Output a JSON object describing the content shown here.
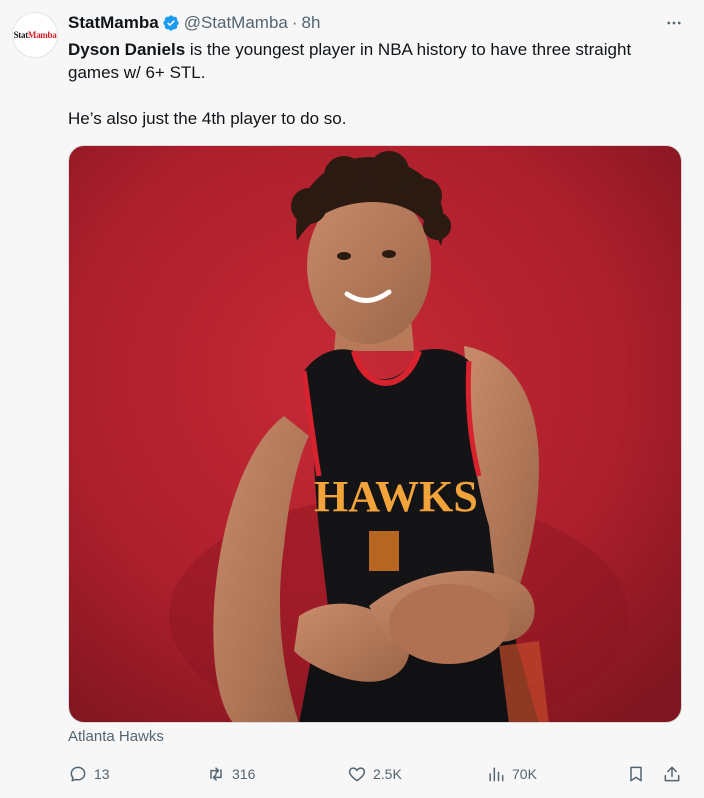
{
  "tweet": {
    "avatar_logo_part1": "Stat",
    "avatar_logo_part2": "Mamba",
    "display_name": "StatMamba",
    "handle": "@StatMamba",
    "separator": "·",
    "time": "8h",
    "more_icon": "more-horizontal-icon",
    "verified_color": "#1d9bf0",
    "text_bold": "Dyson Daniels",
    "text_line1_rest": " is the youngest player in NBA history to have three straight games w/ 6+ STL.",
    "text_line2": "He’s also just the 4th player to do so.",
    "media_caption": "Atlanta Hawks",
    "jersey_text": "HAWKS"
  },
  "actions": {
    "reply_count": "13",
    "retweet_count": "316",
    "like_count": "2.5K",
    "views_count": "70K",
    "bookmark_icon": "bookmark-icon",
    "share_icon": "share-icon"
  },
  "colors": {
    "background": "#f7f7f7",
    "text_secondary": "#536471",
    "media_red": "#b5212e"
  }
}
